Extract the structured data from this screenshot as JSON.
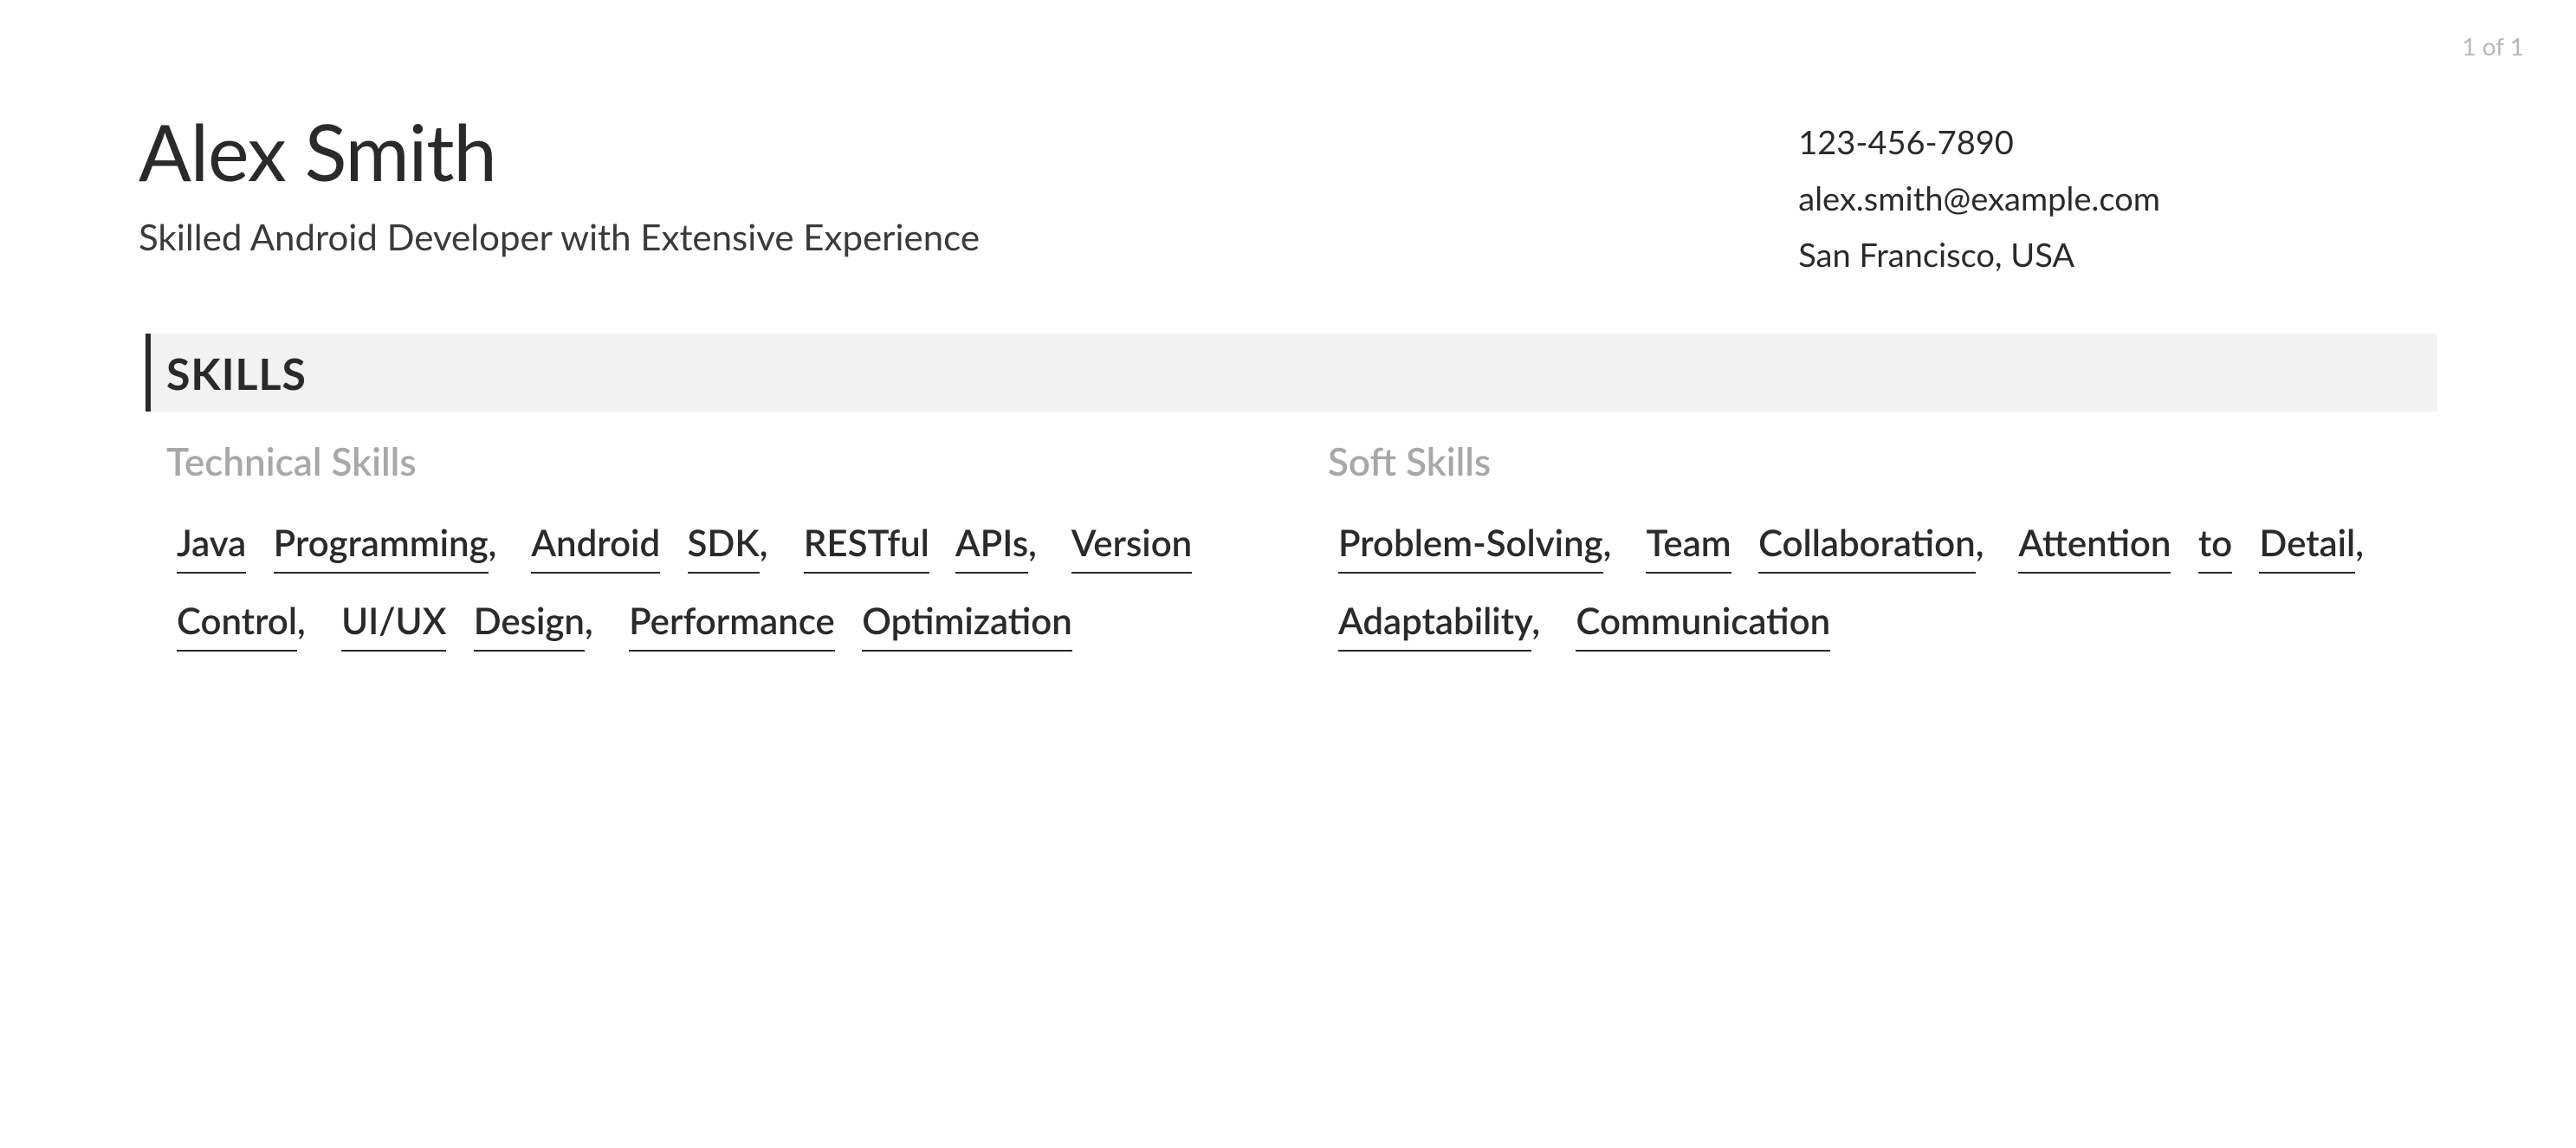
{
  "pageIndicator": "1 of 1",
  "name": "Alex Smith",
  "tagline": "Skilled Android Developer with Extensive Experience",
  "contact": {
    "phone": "123-456-7890",
    "email": "alex.smith@example.com",
    "location": "San Francisco, USA"
  },
  "sections": {
    "skills": {
      "title": "SKILLS",
      "groups": [
        {
          "heading": "Technical Skills",
          "items": [
            "Java Programming",
            "Android SDK",
            "RESTful APIs",
            "Version Control",
            "UI/UX Design",
            "Performance Optimization"
          ]
        },
        {
          "heading": "Soft Skills",
          "items": [
            "Problem-Solving",
            "Team Collaboration",
            "Attention to Detail",
            "Adaptability",
            "Communication"
          ]
        }
      ]
    }
  }
}
